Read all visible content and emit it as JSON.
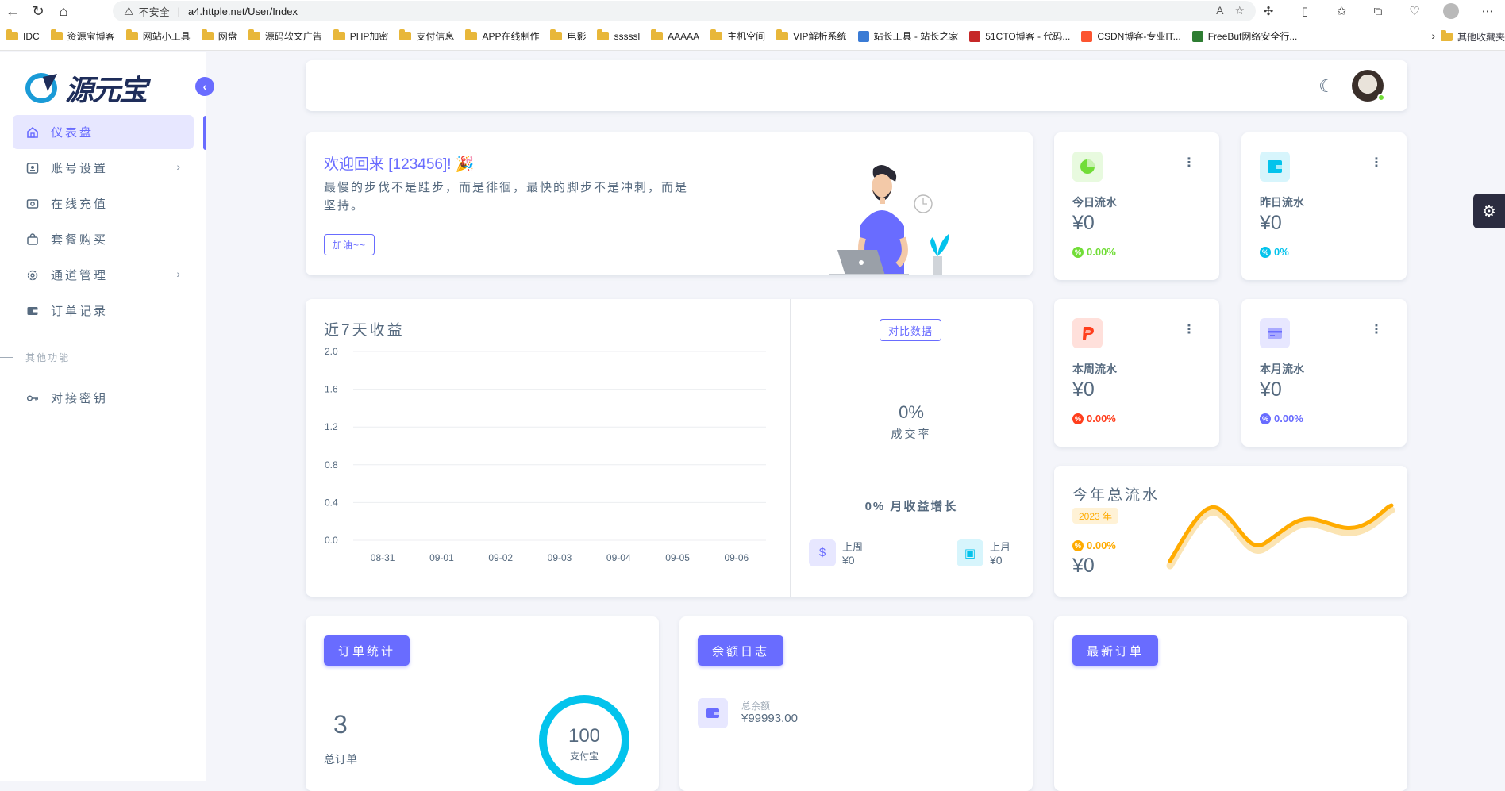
{
  "browser": {
    "security_label": "不安全",
    "url": "a4.httple.net/User/Index",
    "bookmarks": [
      "IDC",
      "资源宝博客",
      "网站小工具",
      "网盘",
      "源码软文广告",
      "PHP加密",
      "支付信息",
      "APP在线制作",
      "电影",
      "sssssl",
      "AAAAA",
      "主机空间",
      "VIP解析系统",
      "站长工具 - 站长之家",
      "51CTO博客 - 代码...",
      "CSDN博客-专业IT...",
      "FreeBuf网络安全行..."
    ],
    "bookmark_other": "其他收藏夹"
  },
  "sidebar": {
    "logo_text": "源元宝",
    "items": [
      {
        "label": "仪表盘",
        "icon": "home-icon"
      },
      {
        "label": "账号设置",
        "icon": "account-icon"
      },
      {
        "label": "在线充值",
        "icon": "wallet-icon"
      },
      {
        "label": "套餐购买",
        "icon": "bag-icon"
      },
      {
        "label": "通道管理",
        "icon": "gear-icon"
      },
      {
        "label": "订单记录",
        "icon": "card-icon"
      }
    ],
    "section_label": "其他功能",
    "extra_items": [
      {
        "label": "对接密钥",
        "icon": "key-icon"
      }
    ]
  },
  "welcome": {
    "title": "欢迎回来 [123456]! 🎉",
    "text": "最慢的步伐不是跬步，而是徘徊，最快的脚步不是冲刺，而是坚持。",
    "button": "加油~~"
  },
  "stats": {
    "today": {
      "label": "今日流水",
      "value": "¥0",
      "change": "0.00%"
    },
    "yesterday": {
      "label": "昨日流水",
      "value": "¥0",
      "change": "0%"
    },
    "week": {
      "label": "本周流水",
      "value": "¥0",
      "change": "0.00%"
    },
    "month": {
      "label": "本月流水",
      "value": "¥0",
      "change": "0.00%"
    }
  },
  "revenue": {
    "title": "近7天收益",
    "compare_button": "对比数据",
    "rate_value": "0%",
    "rate_label": "成交率",
    "month_growth": "0% 月收益增长",
    "last_week_label": "上周",
    "last_week_value": "¥0",
    "last_month_label": "上月",
    "last_month_value": "¥0"
  },
  "chart_data": {
    "type": "bar",
    "categories": [
      "08-31",
      "09-01",
      "09-02",
      "09-03",
      "09-04",
      "09-05",
      "09-06"
    ],
    "values": [
      0,
      0,
      0,
      0,
      0,
      0,
      0
    ],
    "title": "近7天收益",
    "xlabel": "",
    "ylabel": "",
    "ylim": [
      0,
      2.0
    ],
    "yticks": [
      "0.0",
      "0.4",
      "0.8",
      "1.2",
      "1.6",
      "2.0"
    ],
    "grid": true
  },
  "year": {
    "title": "今年总流水",
    "badge": "2023 年",
    "change": "0.00%",
    "value": "¥0"
  },
  "bottom": {
    "orders_button": "订单统计",
    "orders_count": "3",
    "orders_label": "总订单",
    "donut_value": "100",
    "donut_label": "支付宝",
    "balance_button": "余额日志",
    "balance_label": "总余额",
    "balance_value": "¥99993.00",
    "latest_button": "最新订单"
  },
  "colors": {
    "primary": "#696cff",
    "success": "#71dd37",
    "info": "#03c3ec",
    "danger": "#ff3e1d",
    "warning": "#ffab00"
  }
}
